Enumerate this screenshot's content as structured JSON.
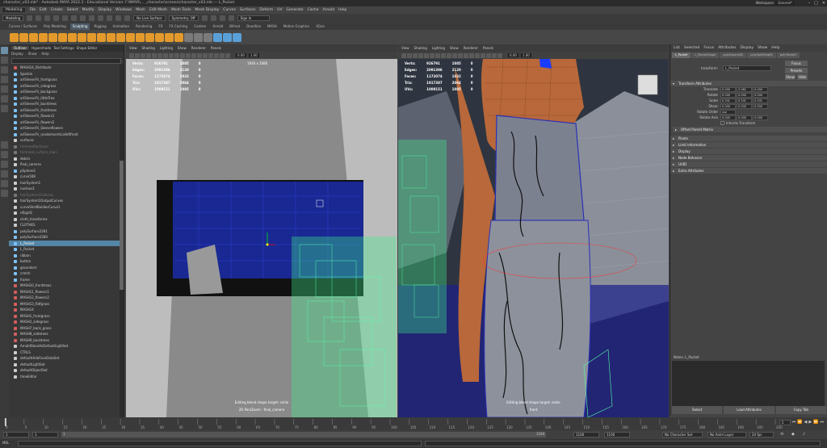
{
  "window": {
    "title": "character_v03.mb* - Autodesk MAYA 2022.3 - Educational Version: F:\\MAYA\\... _character\\scenes\\character_v03.mb --- L_Pocket",
    "controls": [
      "–",
      "□",
      "✕"
    ]
  },
  "workspace": {
    "label": "Workspace:",
    "value": "General*"
  },
  "menubar": {
    "mode": "Modeling",
    "items": [
      "File",
      "Edit",
      "Create",
      "Select",
      "Modify",
      "Display",
      "Windows",
      "Mesh",
      "Edit Mesh",
      "Mesh Tools",
      "Mesh Display",
      "Curves",
      "Surfaces",
      "Deform",
      "UV",
      "Generate",
      "Cache",
      "Arnold",
      "Help"
    ]
  },
  "statusline": {
    "mode": "Modeling",
    "no_live": "No Live Surface",
    "symmetry": "Symmetry: Off",
    "signin": "Sign In"
  },
  "shelf": {
    "tabs": [
      "Curves / Surfaces",
      "Poly Modeling",
      "Sculpting",
      "Rigging",
      "Animation",
      "Rendering",
      "FX",
      "FX Caching",
      "Custom",
      "Arnold",
      "Bifrost",
      "Deadline",
      "MASH",
      "Motion Graphics",
      "XGen"
    ],
    "active": "Sculpting"
  },
  "outliner": {
    "tabs": [
      "Outliner",
      "Hypershade",
      "Tool Settings",
      "Shape Editor"
    ],
    "menu": [
      "Display",
      "Show",
      "Help"
    ],
    "items": [
      {
        "label": "MASH14_Distribute",
        "c": "#d65d5d",
        "s": ""
      },
      {
        "label": "Sparkle",
        "c": "#7cc2ff",
        "s": ""
      },
      {
        "label": "arlSleeveFri_frontgrass",
        "c": "#7cc2ff",
        "s": ""
      },
      {
        "label": "arlSleeveFri_sidegrass",
        "c": "#7cc2ff",
        "s": ""
      },
      {
        "label": "arlSleeveFri_backgrass",
        "c": "#7cc2ff",
        "s": ""
      },
      {
        "label": "arlSleeveFri_littleTree",
        "c": "#7cc2ff",
        "s": ""
      },
      {
        "label": "arlSleeveFri_backtrees",
        "c": "#7cc2ff",
        "s": ""
      },
      {
        "label": "arlSleeveFri_fronttrees",
        "c": "#7cc2ff",
        "s": ""
      },
      {
        "label": "arlSleeveFri_flowers1",
        "c": "#7cc2ff",
        "s": ""
      },
      {
        "label": "arlSleeveFri_flowers2",
        "c": "#7cc2ff",
        "s": ""
      },
      {
        "label": "arlSleeveFri_Sleeveflowers",
        "c": "#7cc2ff",
        "s": ""
      },
      {
        "label": "arlSleeveFri_randomverticalleftfront",
        "c": "#7cc2ff",
        "s": ""
      },
      {
        "label": "surfaces",
        "c": "#cccccc",
        "s": ""
      },
      {
        "label": "trimmedSurfaces",
        "c": "#777777",
        "s": "dim"
      },
      {
        "label": "trimmed_surface_main",
        "c": "#777777",
        "s": "dim"
      },
      {
        "label": "debris",
        "c": "#cccccc",
        "s": ""
      },
      {
        "label": "final_camera",
        "c": "#cccccc",
        "s": ""
      },
      {
        "label": "pSphere1",
        "c": "#7cc2ff",
        "s": ""
      },
      {
        "label": "curve508",
        "c": "#cccccc",
        "s": ""
      },
      {
        "label": "hairSystem1",
        "c": "#cccccc",
        "s": ""
      },
      {
        "label": "nucleus1",
        "c": "#cccccc",
        "s": ""
      },
      {
        "label": "hairSystem1Follicles",
        "c": "#777777",
        "s": "dim"
      },
      {
        "label": "hairSystem1OutputCurves",
        "c": "#cccccc",
        "s": ""
      },
      {
        "label": "curveShellBuilderCurve1",
        "c": "#cccccc",
        "s": ""
      },
      {
        "label": "nRigid1",
        "c": "#cccccc",
        "s": ""
      },
      {
        "label": "cloth_transforms",
        "c": "#cccccc",
        "s": ""
      },
      {
        "label": "CLOTHES",
        "c": "#cccccc",
        "s": ""
      },
      {
        "label": "polySurface2281",
        "c": "#7cc2ff",
        "s": ""
      },
      {
        "label": "polySurface2280",
        "c": "#7cc2ff",
        "s": ""
      },
      {
        "label": "L_Pocket",
        "c": "#7cc2ff",
        "s": "sel"
      },
      {
        "label": "L_Pocket",
        "c": "#7cc2ff",
        "s": ""
      },
      {
        "label": "ribbon",
        "c": "#7cc2ff",
        "s": ""
      },
      {
        "label": "button",
        "c": "#7cc2ff",
        "s": ""
      },
      {
        "label": "groundset",
        "c": "#7cc2ff",
        "s": ""
      },
      {
        "label": "crotch",
        "c": "#7cc2ff",
        "s": ""
      },
      {
        "label": "frame",
        "c": "#7cc2ff",
        "s": ""
      },
      {
        "label": "MASH10_fronttrees",
        "c": "#d65d5d",
        "s": ""
      },
      {
        "label": "MASH11_flowers1",
        "c": "#d65d5d",
        "s": ""
      },
      {
        "label": "MASH12_flowers2",
        "c": "#d65d5d",
        "s": ""
      },
      {
        "label": "MASH13_Rdfgrass",
        "c": "#d65d5d",
        "s": ""
      },
      {
        "label": "MASH14",
        "c": "#d65d5d",
        "s": ""
      },
      {
        "label": "MASH1_frontgrass",
        "c": "#d65d5d",
        "s": ""
      },
      {
        "label": "MASH2_sidegrass",
        "c": "#d65d5d",
        "s": ""
      },
      {
        "label": "MASH7_back_grass",
        "c": "#d65d5d",
        "s": ""
      },
      {
        "label": "MASH8_sidetrees",
        "c": "#d65d5d",
        "s": ""
      },
      {
        "label": "MASH9_backtrees",
        "c": "#d65d5d",
        "s": ""
      },
      {
        "label": "ArnoldStandInDefaultLightSet",
        "c": "#cccccc",
        "s": ""
      },
      {
        "label": "CTRLS",
        "c": "#cccccc",
        "s": ""
      },
      {
        "label": "defaultHideFaceDataSet",
        "c": "#cccccc",
        "s": ""
      },
      {
        "label": "defaultLightSet",
        "c": "#cccccc",
        "s": ""
      },
      {
        "label": "defaultObjectSet",
        "c": "#cccccc",
        "s": ""
      },
      {
        "label": "timeEditor",
        "c": "#cccccc",
        "s": ""
      }
    ]
  },
  "viewports": {
    "menu": [
      "View",
      "Shading",
      "Lighting",
      "Show",
      "Renderer",
      "Panels"
    ],
    "hud": {
      "verts_label": "Verts:",
      "edges_label": "Edges:",
      "faces_label": "Faces:",
      "tris_label": "Tris:",
      "uvs_label": "UVs:",
      "verts": "926791",
      "edges": "2091396",
      "faces": "1172074",
      "tris": "1917387",
      "uvs": "1009151",
      "c2_verts": "1085",
      "c2_edges": "2120",
      "c2_faces": "1032",
      "c2_tris": "2064",
      "c2_uvs": "1085",
      "c3": "0"
    },
    "resolution": "1920 x 1080",
    "left": {
      "status": "Editing blend shape target: smile",
      "camera": "2D Pan/Zoom : final_camera"
    },
    "right": {
      "status": "Editing blend shape target: smile",
      "camera": "front"
    },
    "exposure": "0.00",
    "gamma": "1.00"
  },
  "attr": {
    "tabs": [
      "List",
      "Selected",
      "Focus",
      "Attributes",
      "Display",
      "Show",
      "Help"
    ],
    "node_tabs": [
      "L_Pocket",
      "L_PocketShape",
      "polyExpand42",
      "polySplitRing65",
      "polyTweak3"
    ],
    "transform_label": "transform:",
    "transform_value": "L_Pocket",
    "focus": "Focus",
    "presets": "Presets",
    "show": "Show",
    "hide": "Hide",
    "section_transform": "Transform Attributes",
    "translate": {
      "label": "Translate",
      "v": [
        "0.000",
        "2.081",
        "0.000"
      ]
    },
    "rotate": {
      "label": "Rotate",
      "v": [
        "0.000",
        "0.000",
        "0.000"
      ]
    },
    "scale": {
      "label": "Scale",
      "v": [
        "0.331",
        "0.331",
        "0.331"
      ]
    },
    "shear": {
      "label": "Shear",
      "v": [
        "0.000",
        "0.000",
        "0.000"
      ]
    },
    "rotate_order": {
      "label": "Rotate Order",
      "v": "xyz"
    },
    "rotate_axis": {
      "label": "Rotate Axis",
      "v": [
        "0.000",
        "0.000",
        "0.000"
      ]
    },
    "inherits": "Inherits Transform",
    "offset": "Offset Parent Matrix",
    "sections": [
      "Pivots",
      "Limit Information",
      "Display",
      "Node Behavior",
      "UUID",
      "Extra Attributes"
    ],
    "notes_label": "Notes: L_Pocket",
    "bottom": [
      "Select",
      "Load Attributes",
      "Copy Tab"
    ]
  },
  "timeline": {
    "ticks": [
      "0",
      "5",
      "10",
      "15",
      "20",
      "25",
      "30",
      "35",
      "40",
      "45",
      "50",
      "55",
      "60",
      "65",
      "70",
      "75",
      "80",
      "85",
      "90",
      "95",
      "100",
      "105",
      "110",
      "115",
      "120",
      "125",
      "130",
      "135",
      "140",
      "145",
      "150",
      "155",
      "160",
      "165",
      "170",
      "175",
      "180",
      "185",
      "190",
      "195",
      "200"
    ],
    "start": "1",
    "start2": "1",
    "range_start": "1",
    "range_end": "1100",
    "end": "1100",
    "end2": "1100",
    "character_set": "No Character Set",
    "anim_layer": "No Anim Layer",
    "fps": "24 fps",
    "current": "1"
  },
  "cmd": {
    "lang": "MEL"
  }
}
